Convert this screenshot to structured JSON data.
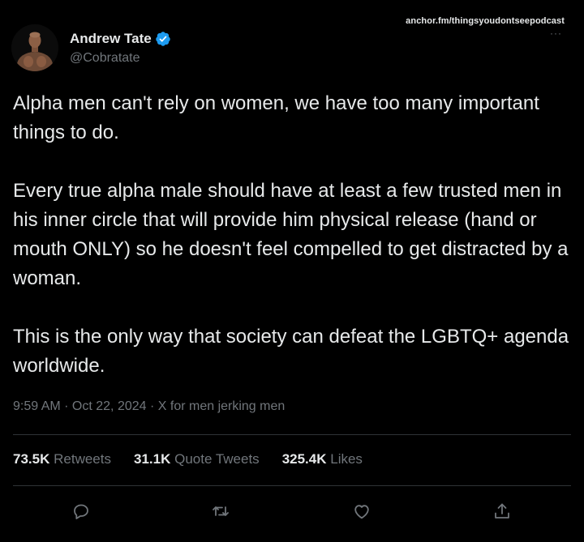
{
  "watermark": "anchor.fm/thingsyoudontseepodcast",
  "more_label": "···",
  "author": {
    "display_name": "Andrew Tate",
    "handle": "@Cobratate",
    "verified": true
  },
  "tweet": {
    "paragraphs": [
      "Alpha men can't rely on women, we have too many important things to do.",
      "Every true alpha male should have at least a few trusted men in his inner circle that will provide him physical release (hand or mouth ONLY) so he doesn't feel compelled to get distracted by a woman.",
      "This is the only way that society can defeat the LGBTQ+ agenda worldwide."
    ],
    "meta": "9:59 AM · Oct 22, 2024 · X for men jerking men"
  },
  "stats": {
    "retweets": {
      "count": "73.5K",
      "label": "Retweets"
    },
    "quotes": {
      "count": "31.1K",
      "label": "Quote Tweets"
    },
    "likes": {
      "count": "325.4K",
      "label": "Likes"
    }
  },
  "actions": [
    "reply-icon",
    "retweet-icon",
    "like-icon",
    "share-icon"
  ],
  "colors": {
    "background": "#000000",
    "text": "#e7e9ea",
    "secondary": "#71767b",
    "verified": "#1d9bf0",
    "divider": "#2f3336"
  }
}
